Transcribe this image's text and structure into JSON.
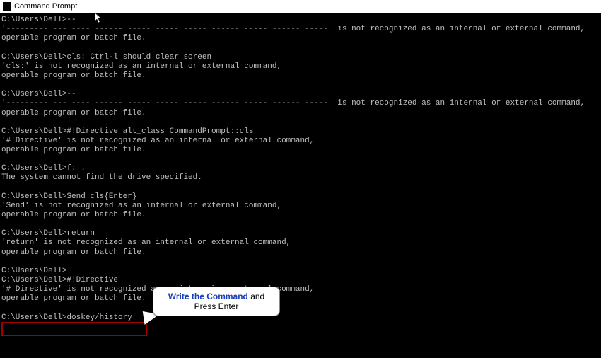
{
  "titlebar": {
    "title": "Command Prompt"
  },
  "terminal": {
    "lines": [
      "C:\\Users\\Dell>--",
      "'--------- --- ---- ------ ----- ----- ----- ------ ----- ------ -----  is not recognized as an internal or external command,",
      "operable program or batch file.",
      "",
      "C:\\Users\\Dell>cls: Ctrl-l should clear screen",
      "'cls:' is not recognized as an internal or external command,",
      "operable program or batch file.",
      "",
      "C:\\Users\\Dell>--",
      "'--------- --- ---- ------ ----- ----- ----- ------ ----- ------ -----  is not recognized as an internal or external command,",
      "operable program or batch file.",
      "",
      "C:\\Users\\Dell>#!Directive alt_class CommandPrompt::cls",
      "'#!Directive' is not recognized as an internal or external command,",
      "operable program or batch file.",
      "",
      "C:\\Users\\Dell>f: .",
      "The system cannot find the drive specified.",
      "",
      "C:\\Users\\Dell>Send cls{Enter}",
      "'Send' is not recognized as an internal or external command,",
      "operable program or batch file.",
      "",
      "C:\\Users\\Dell>return",
      "'return' is not recognized as an internal or external command,",
      "operable program or batch file.",
      "",
      "C:\\Users\\Dell>",
      "C:\\Users\\Dell>#!Directive",
      "'#!Directive' is not recognized as an internal or external command,",
      "operable program or batch file.",
      "",
      "C:\\Users\\Dell>doskey/history"
    ]
  },
  "callout": {
    "bold": "Write the Command",
    "rest": " and Press Enter"
  }
}
